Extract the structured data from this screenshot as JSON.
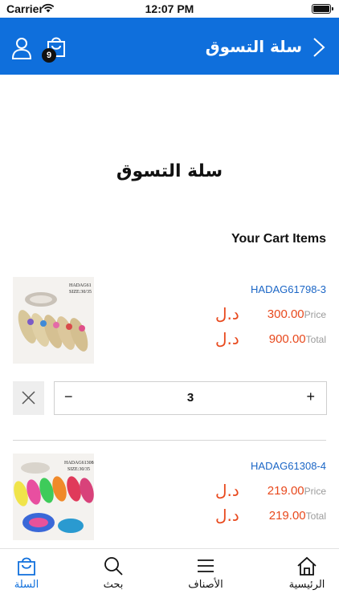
{
  "status_bar": {
    "carrier": "Carrier",
    "time": "12:07 PM"
  },
  "app_bar": {
    "title": "سلة التسوق",
    "cart_count": "9"
  },
  "page": {
    "heading": "سلة التسوق",
    "section_title": "Your Cart Items"
  },
  "labels": {
    "price": "Price",
    "total": "Total",
    "currency": "د.ل"
  },
  "items": [
    {
      "code": "HADAG61798-3",
      "price": "300.00",
      "total": "900.00",
      "quantity": "3",
      "image_text": "HADAG61798-3 SIZE:30/35"
    },
    {
      "code": "HADAG61308-4",
      "price": "219.00",
      "total": "219.00",
      "image_text": "HADAG61308-4 SIZE:30/35"
    }
  ],
  "controls": {
    "minus": "−",
    "plus": "+"
  },
  "bottom_nav": {
    "cart": "السلة",
    "search": "بحث",
    "categories": "الأصناف",
    "home": "الرئيسية"
  },
  "colors": {
    "accent": "#0f6fdc",
    "price": "#e8491d",
    "code": "#1b66c6"
  }
}
